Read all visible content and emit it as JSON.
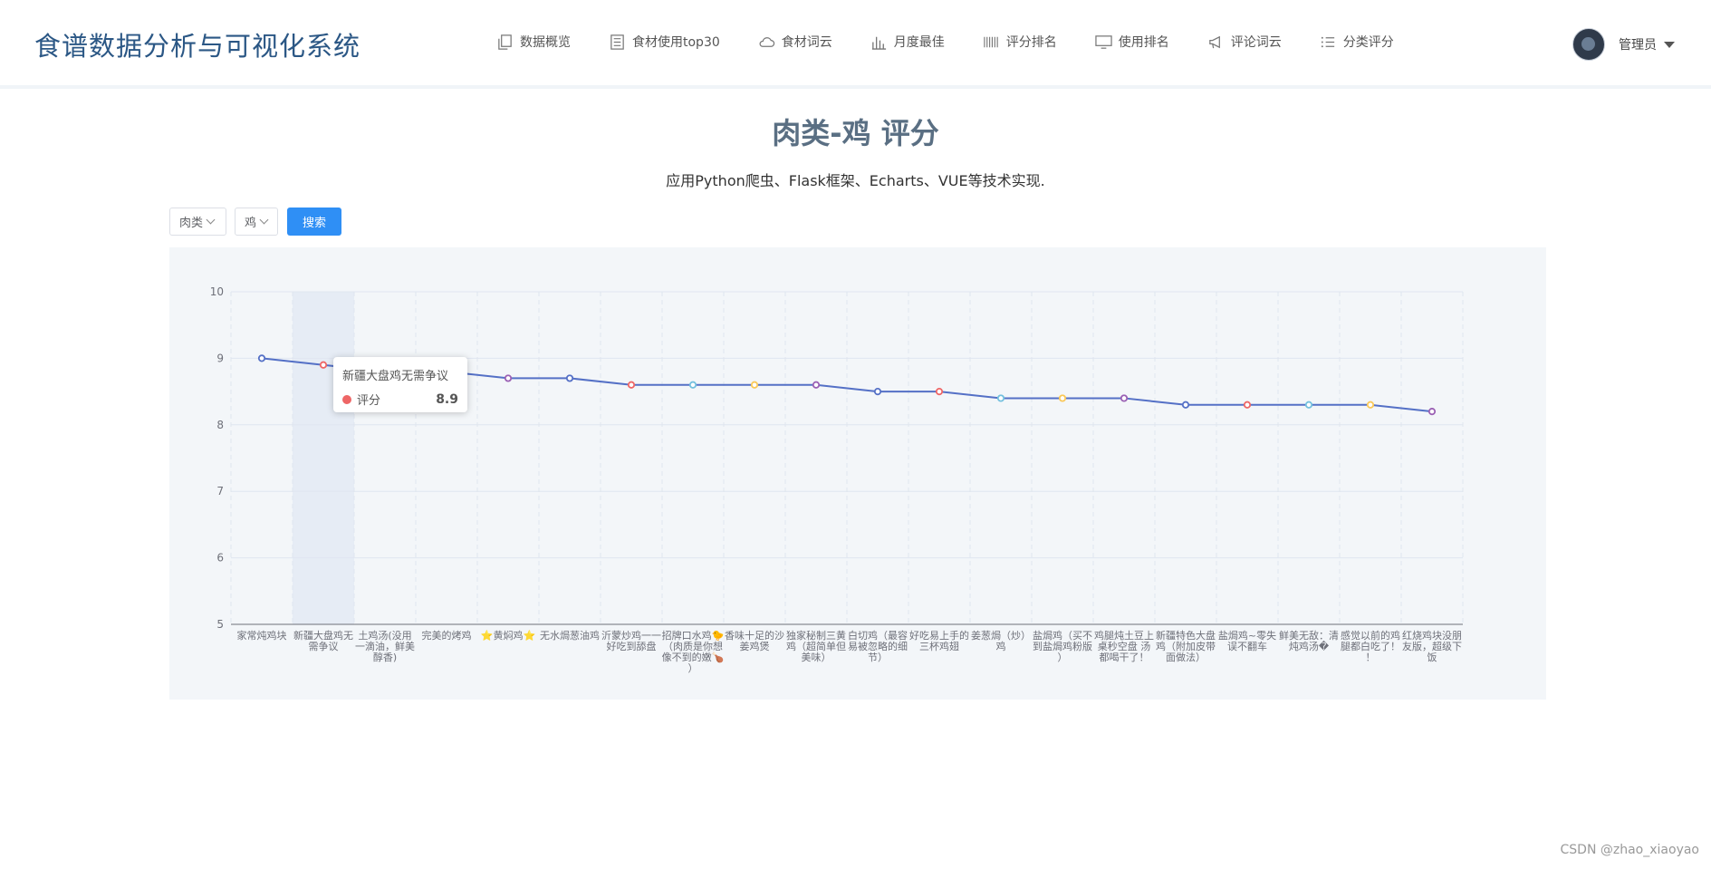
{
  "app": {
    "title": "食谱数据分析与可视化系统"
  },
  "nav": [
    {
      "label": "数据概览",
      "icon": "copy-icon"
    },
    {
      "label": "食材使用top30",
      "icon": "list-icon"
    },
    {
      "label": "食材词云",
      "icon": "cloud-icon"
    },
    {
      "label": "月度最佳",
      "icon": "bar-chart-icon"
    },
    {
      "label": "评分排名",
      "icon": "barcode-icon"
    },
    {
      "label": "使用排名",
      "icon": "monitor-icon"
    },
    {
      "label": "评论词云",
      "icon": "megaphone-icon"
    },
    {
      "label": "分类评分",
      "icon": "bullet-list-icon"
    }
  ],
  "user": {
    "name": "管理员"
  },
  "page": {
    "title": "肉类-鸡 评分",
    "subtitle": "应用Python爬虫、Flask框架、Echarts、VUE等技术实现."
  },
  "filters": {
    "category": "肉类",
    "subcategory": "鸡",
    "search_label": "搜索"
  },
  "chart_data": {
    "type": "line",
    "ylim": [
      5,
      10
    ],
    "yticks": [
      5,
      6,
      7,
      8,
      9,
      10
    ],
    "grid": true,
    "categories": [
      "家常炖鸡块",
      "新疆大盘鸡无需争议",
      "土鸡汤(没用一滴油，鲜美醇香)",
      "完美的烤鸡",
      "⭐黄焖鸡⭐",
      "无水焗葱油鸡",
      "沂蒙炒鸡一一好吃到舔盘",
      "招牌口水鸡🐤（肉质是你想像不到的嫩🍗）",
      "香味十足的沙姜鸡煲",
      "独家秘制三黄鸡（超简单但美味）",
      "白切鸡（最容易被忽略的细节）",
      "好吃易上手的三杯鸡翅",
      "姜葱焗（炒）鸡",
      "盐焗鸡（买不到盐焗鸡粉版）",
      "鸡腿炖土豆上桌秒空盘 汤都喝干了！",
      "新疆特色大盘鸡（附加皮带面做法）",
      "盐焗鸡~零失误不翻车",
      "鲜美无敌：清炖鸡汤�",
      "感觉以前的鸡腿都白吃了！！",
      "红烧鸡块没朋友版，超级下饭"
    ],
    "series": [
      {
        "name": "评分",
        "values": [
          9.0,
          8.9,
          8.8,
          8.8,
          8.7,
          8.7,
          8.6,
          8.6,
          8.6,
          8.6,
          8.5,
          8.5,
          8.4,
          8.4,
          8.4,
          8.3,
          8.3,
          8.3,
          8.3,
          8.2
        ]
      }
    ],
    "highlight_index": 1,
    "line_color": "#5470c6",
    "point_colors": [
      "#5470c6",
      "#ee6666",
      "#73c0de",
      "#3ba272",
      "#9a60b4",
      "#5470c6",
      "#ee6666",
      "#73c0de",
      "#fac858",
      "#9a60b4",
      "#5470c6",
      "#ee6666",
      "#73c0de",
      "#fac858",
      "#9a60b4",
      "#5470c6",
      "#ee6666",
      "#73c0de",
      "#fac858",
      "#9a60b4"
    ]
  },
  "tooltip": {
    "title": "新疆大盘鸡无需争议",
    "series_name": "评分",
    "value": "8.9"
  },
  "watermark": "CSDN @zhao_xiaoyao"
}
